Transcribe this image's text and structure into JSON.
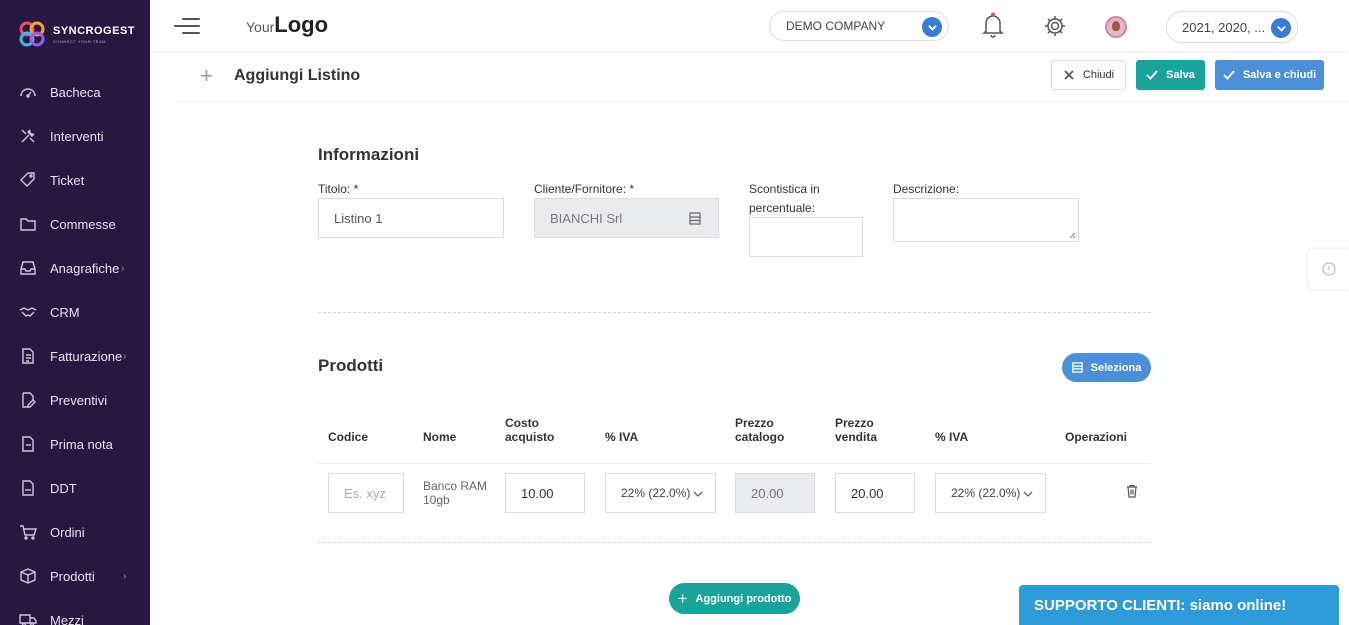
{
  "brand": {
    "name": "SYNCROGEST",
    "tagline": "CONNECT YOUR TEAM"
  },
  "sidebar": {
    "items": [
      {
        "label": "Bacheca",
        "icon": "dashboard-icon",
        "submenu": false
      },
      {
        "label": "Interventi",
        "icon": "tools-icon",
        "submenu": false
      },
      {
        "label": "Ticket",
        "icon": "tag-icon",
        "submenu": false
      },
      {
        "label": "Commesse",
        "icon": "folder-icon",
        "submenu": false
      },
      {
        "label": "Anagrafiche",
        "icon": "inbox-icon",
        "submenu": true
      },
      {
        "label": "CRM",
        "icon": "handshake-icon",
        "submenu": false
      },
      {
        "label": "Fatturazione",
        "icon": "document-icon",
        "submenu": true
      },
      {
        "label": "Preventivi",
        "icon": "edit-document-icon",
        "submenu": false
      },
      {
        "label": "Prima nota",
        "icon": "note-icon",
        "submenu": false
      },
      {
        "label": "DDT",
        "icon": "ddt-file-icon",
        "submenu": false
      },
      {
        "label": "Ordini",
        "icon": "cart-icon",
        "submenu": false
      },
      {
        "label": "Prodotti",
        "icon": "box-icon",
        "submenu": true
      },
      {
        "label": "Mezzi",
        "icon": "truck-icon",
        "submenu": false
      }
    ]
  },
  "topbar": {
    "logo_light": "Your",
    "logo_bold": "Logo",
    "company": "DEMO COMPANY",
    "years": "2021, 2020, ..."
  },
  "header": {
    "title": "Aggiungi Listino",
    "close_label": "Chiudi",
    "save_label": "Salva",
    "save_close_label": "Salva e chiudi"
  },
  "info": {
    "section_title": "Informazioni",
    "title_label": "Titolo: *",
    "title_value": "Listino 1",
    "client_label": "Cliente/Fornitore: *",
    "client_value": "BIANCHI Srl",
    "discount_label": "Scontistica in percentuale:",
    "discount_value": "",
    "description_label": "Descrizione:",
    "description_value": ""
  },
  "products": {
    "section_title": "Prodotti",
    "select_label": "Seleziona",
    "columns": [
      "Codice",
      "Nome",
      "Costo acquisto",
      "% IVA",
      "Prezzo catalogo",
      "Prezzo vendita",
      "% IVA",
      "Operazioni"
    ],
    "rows": [
      {
        "code_placeholder": "Es. xyz",
        "name": "Banco RAM 10gb",
        "cost": "10.00",
        "vat1": "22% (22.0%)",
        "catalog_price": "20.00",
        "sale_price": "20.00",
        "vat2": "22% (22.0%)"
      }
    ],
    "add_label": "Aggiungi prodotto"
  },
  "support": {
    "label": "SUPPORTO CLIENTI: siamo online!"
  },
  "colors": {
    "sidebar": "#2a1741",
    "teal": "#1aa39a",
    "blue": "#4a8fd8",
    "support": "#2f9ad8"
  }
}
